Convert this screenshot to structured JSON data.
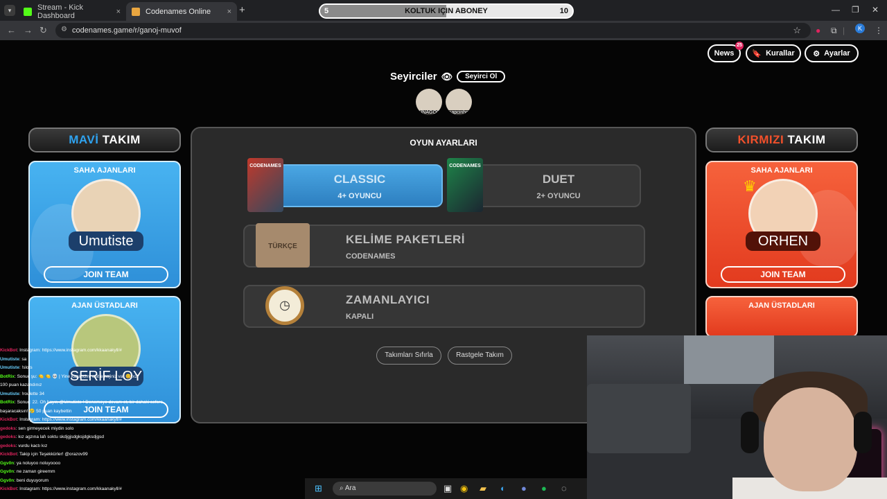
{
  "browser": {
    "tabs": [
      {
        "label": "Stream - Kick Dashboard",
        "favicon_color": "#53fc18"
      },
      {
        "label": "Codenames Online",
        "favicon_color": "#e9a640"
      }
    ],
    "close_glyph": "×",
    "new_tab_glyph": "+",
    "url": "codenames.game/r/ganoj-muvof",
    "profile_initial": "K"
  },
  "sub_goal": {
    "label": "KOLTUK IÇIN ABONEY",
    "current": "5",
    "target": "10",
    "progress": 0.5
  },
  "header": {
    "news_label": "News",
    "news_badge": "25",
    "rules_label": "Kurallar",
    "settings_label": "Ayarlar"
  },
  "spectators": {
    "title": "Seyirciler",
    "become_label": "Seyirci Ol",
    "users": [
      "SİNAGOG",
      "sapcinho"
    ]
  },
  "blue_team": {
    "title_colored": "MAVİ",
    "title_rest": " TAKIM",
    "operatives_title": "SAHA AJANLARI",
    "operative_name": "Umutiste",
    "join_label": "JOIN TEAM",
    "spymasters_title": "AJAN ÜSTADLARI",
    "spymaster_name": "SERİF LOY",
    "spymaster_join_label": "JOIN TEAM"
  },
  "red_team": {
    "title_colored": "KIRMIZI",
    "title_rest": " TAKIM",
    "operatives_title": "SAHA AJANLARI",
    "operative_name": "ORHEN",
    "join_label": "JOIN TEAM",
    "spymasters_title": "AJAN ÜSTADLARI"
  },
  "game_settings": {
    "title": "OYUN AYARLARI",
    "modes": [
      {
        "title": "CLASSIC",
        "subtitle": "4+ OYUNCU",
        "selected": true
      },
      {
        "title": "DUET",
        "subtitle": "2+ OYUNCU",
        "selected": false
      }
    ],
    "classic_box_label": "CODENAMES",
    "duet_box_label": "CODENAMES",
    "word_packs": {
      "title": "KELİME PAKETLERİ",
      "subtitle": "CODENAMES",
      "box_label": "TÜRKÇE"
    },
    "timer": {
      "title": "ZAMANLAYICI",
      "subtitle": "KAPALI"
    },
    "reset_teams_label": "Takımları Sıfırla",
    "random_teams_label": "Rastgele Takım"
  },
  "chat": [
    {
      "user": "KickBot",
      "text": ": Instagram: https://www.instagram.com/kkaanakyll/#",
      "color": "#e0245e"
    },
    {
      "user": "Umutiste",
      "text": ": sa",
      "color": "#6ad0ff"
    },
    {
      "user": "Umutiste",
      "text": ": !slots",
      "color": "#6ad0ff"
    },
    {
      "user": "BotRix",
      "text": ": Sonuç şu: 🍋 🍋 💀 | Yine kazandın! eşit emojiniz var 😊 x2!",
      "color": "#53fc18"
    },
    {
      "user": "",
      "text": "100 puan kazandınız",
      "color": "#ffffff"
    },
    {
      "user": "Umutiste",
      "text": ": !roulette 34",
      "color": "#6ad0ff"
    },
    {
      "user": "BotRix",
      "text": ": Sonuç: 22. Oh hayır, @Umutiste ! Denemeye devam et, bir dahaki sefere",
      "color": "#53fc18"
    },
    {
      "user": "",
      "text": "başaracaksın! 😢 50 puan kaybettin",
      "color": "#ffffff"
    },
    {
      "user": "KickBot",
      "text": ": Instagram: https://www.instagram.com/kkaanakyll/#",
      "color": "#e0245e"
    },
    {
      "user": "gedoks",
      "text": ": sen girmeyecek miydin solo",
      "color": "#e0245e"
    },
    {
      "user": "gedoks",
      "text": ": kız agzına lafı soktu skdjgjsdgksjdgksdjgsd",
      "color": "#e0245e"
    },
    {
      "user": "gedoks",
      "text": ": vurdu kactı kız",
      "color": "#e0245e"
    },
    {
      "user": "KickBot",
      "text": ": Takip için Teşekkürler! @orazov99",
      "color": "#e0245e"
    },
    {
      "user": "Ggv0n",
      "text": ": ya noluyoo noluyoooo",
      "color": "#53fc18"
    },
    {
      "user": "Ggv0n",
      "text": ": ne zaman gireemm",
      "color": "#53fc18"
    },
    {
      "user": "Ggv0n",
      "text": ": beni duyuyorum",
      "color": "#53fc18"
    },
    {
      "user": "KickBot",
      "text": ": Instagram: https://www.instagram.com/kkaanakyll/#",
      "color": "#e0245e"
    }
  ],
  "taskbar": {
    "search_placeholder": "Ara"
  }
}
